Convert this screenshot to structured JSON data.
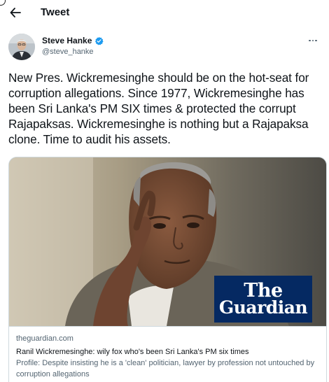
{
  "header": {
    "title": "Tweet"
  },
  "author": {
    "display_name": "Steve Hanke",
    "handle": "@steve_hanke",
    "verified_color": "#1d9bf0"
  },
  "tweet": {
    "text": "New Pres. Wickremesinghe should be on the hot-seat for corruption allegations. Since 1977, Wickremesinghe has been Sri Lanka's PM SIX times & protected the corrupt Rajapaksas. Wickremesinghe is nothing but a Rajapaksa clone. Time to audit his assets."
  },
  "link_card": {
    "logo_line1": "The",
    "logo_line2": "Guardian",
    "logo_color": "#052962",
    "domain": "theguardian.com",
    "title": "Ranil Wickremesinghe: wily fox who's been Sri Lanka's PM six times",
    "description": "Profile: Despite insisting he is a 'clean' politician, lawyer by profession not untouched by corruption allegations"
  },
  "icons": {
    "back": "arrow-left-icon",
    "verified": "verified-badge-icon",
    "more": "more-options-icon"
  }
}
